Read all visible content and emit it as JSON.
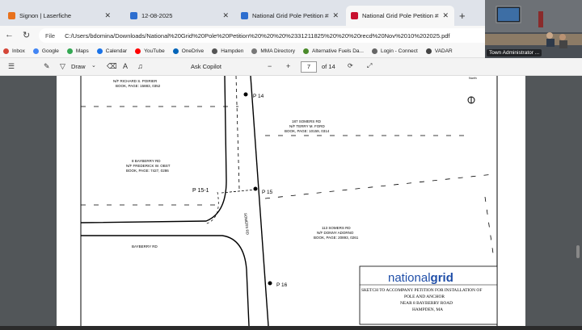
{
  "tabs": [
    {
      "title": "Signon | Laserfiche",
      "color": "#e8711c",
      "active": false
    },
    {
      "title": "12-08-2025",
      "color": "#2d6ecf",
      "active": false
    },
    {
      "title": "National Grid Pole Petition #3121",
      "color": "#2d6ecf",
      "active": false
    },
    {
      "title": "National Grid Pole Petition #3121",
      "color": "#c8102e",
      "active": true
    }
  ],
  "address": {
    "scheme_label": "File",
    "url": "C:/Users/bdomina/Downloads/National%20Grid%20Pole%20Petition%20%20%20%2331211825%20%20%20recd%20Nov%2010%202025.pdf"
  },
  "bookmarks": [
    {
      "label": "Inbox",
      "color": "#d44638"
    },
    {
      "label": "Google",
      "color": "#4285f4"
    },
    {
      "label": "Maps",
      "color": "#34a853"
    },
    {
      "label": "Calendar",
      "color": "#1a73e8"
    },
    {
      "label": "YouTube",
      "color": "#ff0000"
    },
    {
      "label": "OneDrive",
      "color": "#0364b8"
    },
    {
      "label": "Hampden",
      "color": "#555555"
    },
    {
      "label": "MMA Directory",
      "color": "#777777"
    },
    {
      "label": "Alternative Fuels Da...",
      "color": "#4a8a2a"
    },
    {
      "label": "Login - Connect",
      "color": "#666666"
    },
    {
      "label": "VADAR",
      "color": "#444444"
    }
  ],
  "pdf_toolbar": {
    "draw_label": "Draw",
    "copilot_label": "Ask Copilot",
    "zoom_minus": "−",
    "zoom_plus": "+",
    "page_current": "7",
    "page_total": "of 14"
  },
  "video": {
    "participant_name": "Town Administrator ..."
  },
  "drawing": {
    "labels": {
      "nf_richard": "N/F RICHARD S. POIRIER",
      "book_richard": "BOOK, PAGE: 15883, 0352",
      "p14": "P 14",
      "somers187_a": "187 SOMERS RD",
      "somers187_b": "N/F TERRY M. FORD",
      "somers187_c": "BOOK, PAGE: 10159, 0314",
      "bayberry8_a": "8 BAYBERRY RD",
      "bayberry8_b": "N/F FREDERICK W. OBST",
      "bayberry8_c": "BOOK, PAGE: 7427, 0286",
      "p15_1": "P 15-1",
      "p15": "P 15",
      "somers_rd": "SOMERS RD",
      "somers113_a": "113 SOMERS RD",
      "somers113_b": "N/F DONNY ADORNO",
      "somers113_c": "BOOK, PAGE: 20893, 0261",
      "bayberry_rd": "BAYBERRY RD",
      "p16": "P 16",
      "north": "North"
    },
    "title_block": {
      "logo_national": "national",
      "logo_grid": "grid",
      "line1": "SKETCH TO ACCOMPANY PETITION FOR INSTALLATION OF",
      "line2": "POLE AND ANCHOR",
      "line3": "NEAR 8 BAYBERRY ROAD",
      "line4": "HAMPDEN, MA"
    }
  }
}
